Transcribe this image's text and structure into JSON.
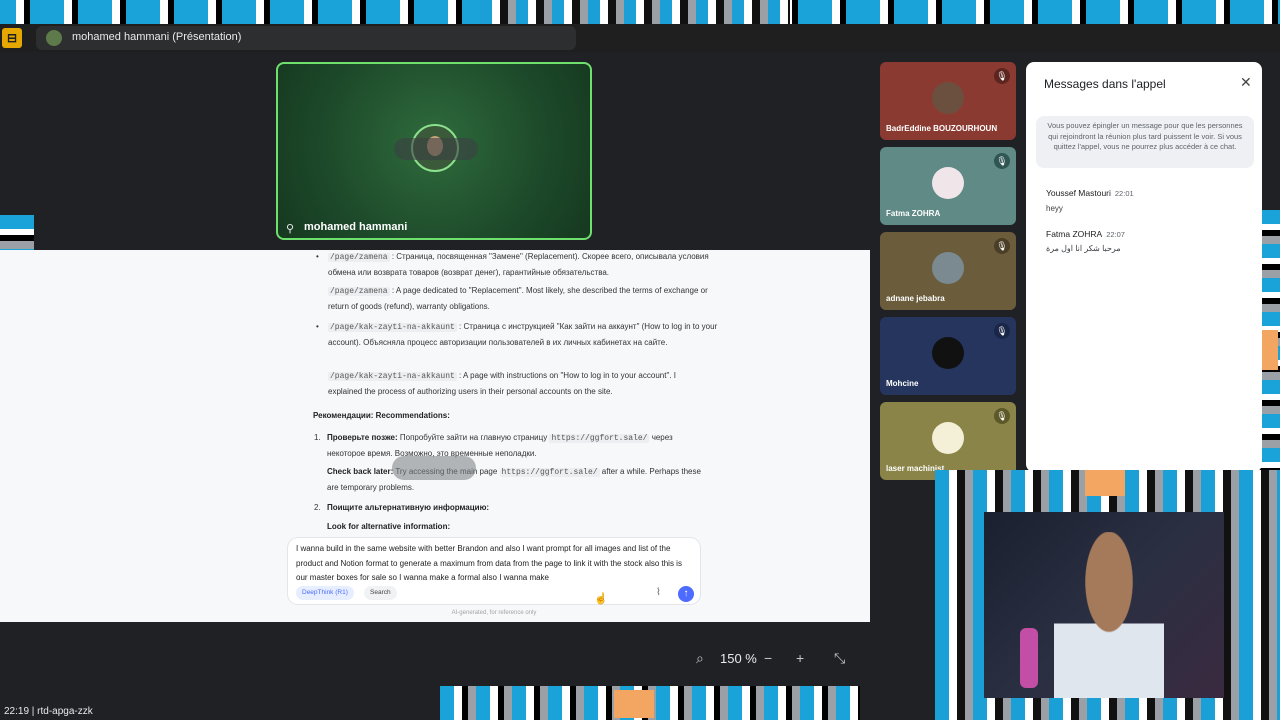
{
  "meeting": {
    "presentation_title": "mohamed hammani (Présentation)",
    "presenter_name": "mohamed hammani"
  },
  "doc": {
    "b1_code": "/page/zamena",
    "b1_ru": " : Страница, посвященная \"Замене\" (Replacement). Скорее всего, описывала условия обмена или возврата товаров (возврат денег), гарантийные обязательства.",
    "b1_code2": "/page/zamena",
    "b1_en": " : A page dedicated to \"Replacement\". Most likely, she described the terms of exchange or return of goods (refund), warranty obligations.",
    "b2_code": "/page/kak-zayti-na-akkaunt",
    "b2_ru": " : Страница с инструкцией \"Как зайти на аккаунт\" (How to log in to your account). Объясняла процесс авторизации пользователей в их личных кабинетах на сайте.",
    "b2_code2": "/page/kak-zayti-na-akkaunt",
    "b2_en": " : A page with instructions on \"How to log in to your account\". I explained the process of authorizing users in their personal accounts on the site.",
    "rec_heading": "Рекомендации:  Recommendations:",
    "r1_bold": "Проверьте позже:",
    "r1_text": " Попробуйте зайти на главную страницу ",
    "r1_code": "https://ggfort.sale/",
    "r1_text2": " через некоторое время. Возможно, это временные неполадки.",
    "r1_en_bold": "Check back later:",
    "r1_en_text": " Try accessing the main page ",
    "r1_en_code": "https://ggfort.sale/",
    "r1_en_text2": " after a while. Perhaps these are temporary problems.",
    "r2_bold": "Поищите альтернативную информацию:",
    "r2_en_bold": "Look for alternative information:"
  },
  "prompt": {
    "text": "I wanna build in the same website with better Brandon and also I want prompt for all images and list of the product and Notion format to generate a maximum from data from the page to link it with the stock also this is our master boxes for sale so I wanna make a formal also I wanna make",
    "chip_deepthink": "DeepThink (R1)",
    "chip_search": "Search",
    "disclaimer": "AI-generated, for reference only"
  },
  "zoom": {
    "value": "150 %"
  },
  "participants": [
    {
      "name": "BadrEddine BOUZOURHOUN",
      "bg": "#8b3a32",
      "mic_bg": "#5c2520"
    },
    {
      "name": "Fatma ZOHRA",
      "bg": "#5f8a86",
      "mic_bg": "#2f5652"
    },
    {
      "name": "adnane jebabra",
      "bg": "#6b5d3c",
      "mic_bg": "#4a3f26"
    },
    {
      "name": "Mohcine",
      "bg": "#25355e",
      "mic_bg": "#1a2648"
    },
    {
      "name": "laser machinist",
      "bg": "#8a8448",
      "mic_bg": "#5c5828"
    }
  ],
  "chat": {
    "title": "Messages dans l'appel",
    "info": "Vous pouvez épingler un message pour que les personnes qui rejoindront la réunion plus tard puissent le voir. Si vous quittez l'appel, vous ne pourrez plus accéder à ce chat.",
    "messages": [
      {
        "sender": "Youssef Mastouri",
        "time": "22:01",
        "text": "heyy"
      },
      {
        "sender": "Fatma ZOHRA",
        "time": "22:07",
        "text": "مرحبا شكر انا اول مرة"
      }
    ]
  },
  "taskbar": {
    "text": "22:19  |  rtd-apga-zzk"
  },
  "colors": {
    "presenter_border": "#6ee06e",
    "send_button": "#4d6bfe",
    "frame_blue": "#1aa3d9"
  }
}
